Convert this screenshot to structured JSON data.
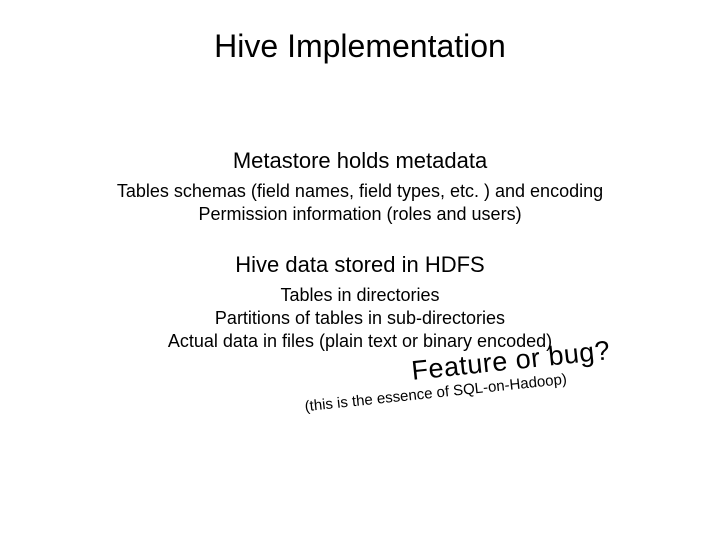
{
  "title": "Hive Implementation",
  "section1": {
    "heading": "Metastore holds metadata",
    "line1": "Tables schemas (field names, field types, etc. ) and encoding",
    "line2": "Permission information (roles and users)"
  },
  "section2": {
    "heading": "Hive data stored in HDFS",
    "line1": "Tables in directories",
    "line2": "Partitions of tables in sub-directories",
    "line3": "Actual data in files (plain text or binary encoded)"
  },
  "annotation": {
    "big": "Feature or bug?",
    "small": "(this is the essence of SQL-on-Hadoop)"
  }
}
